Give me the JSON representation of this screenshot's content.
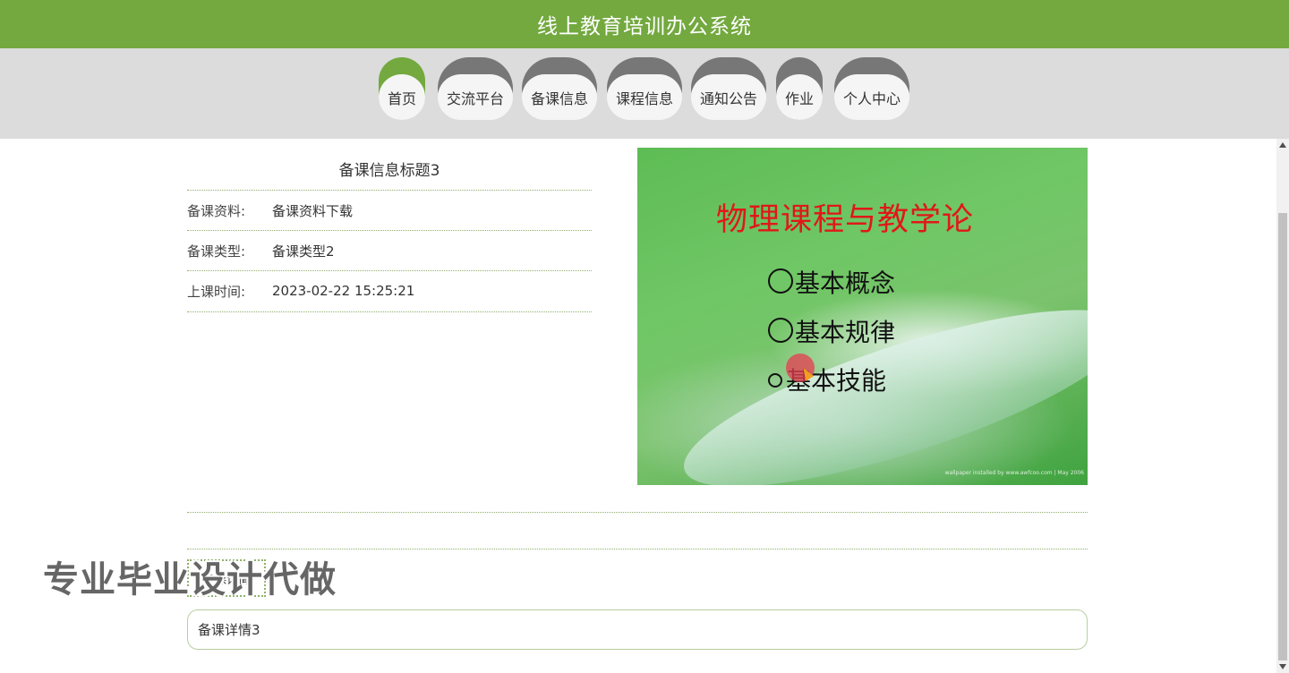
{
  "app": {
    "title": "线上教育培训办公系统"
  },
  "nav": {
    "items": [
      {
        "label": "首页",
        "active": true
      },
      {
        "label": "交流平台"
      },
      {
        "label": "备课信息"
      },
      {
        "label": "课程信息"
      },
      {
        "label": "通知公告"
      },
      {
        "label": "作业"
      },
      {
        "label": "个人中心"
      }
    ]
  },
  "info": {
    "title": "备课信息标题3",
    "rows": [
      {
        "label": "备课资料:",
        "value": "备课资料下载"
      },
      {
        "label": "备课类型:",
        "value": "备课类型2"
      },
      {
        "label": "上课时间:",
        "value": "2023-02-22 15:25:21"
      }
    ]
  },
  "cover": {
    "title": "物理课程与教学论",
    "items": [
      "基本概念",
      "基本规律",
      "基本技能"
    ],
    "credit": "wallpaper installed by www.awfcoo.com | May 2006"
  },
  "detail": {
    "tab_label": "备课详情",
    "content": "备课详情3"
  },
  "watermark": "专业毕业设计代做",
  "colors": {
    "header": "#73a93f",
    "nav_band": "#dcdcdc",
    "nav_cap": "#777777",
    "accent": "#73a93f"
  }
}
